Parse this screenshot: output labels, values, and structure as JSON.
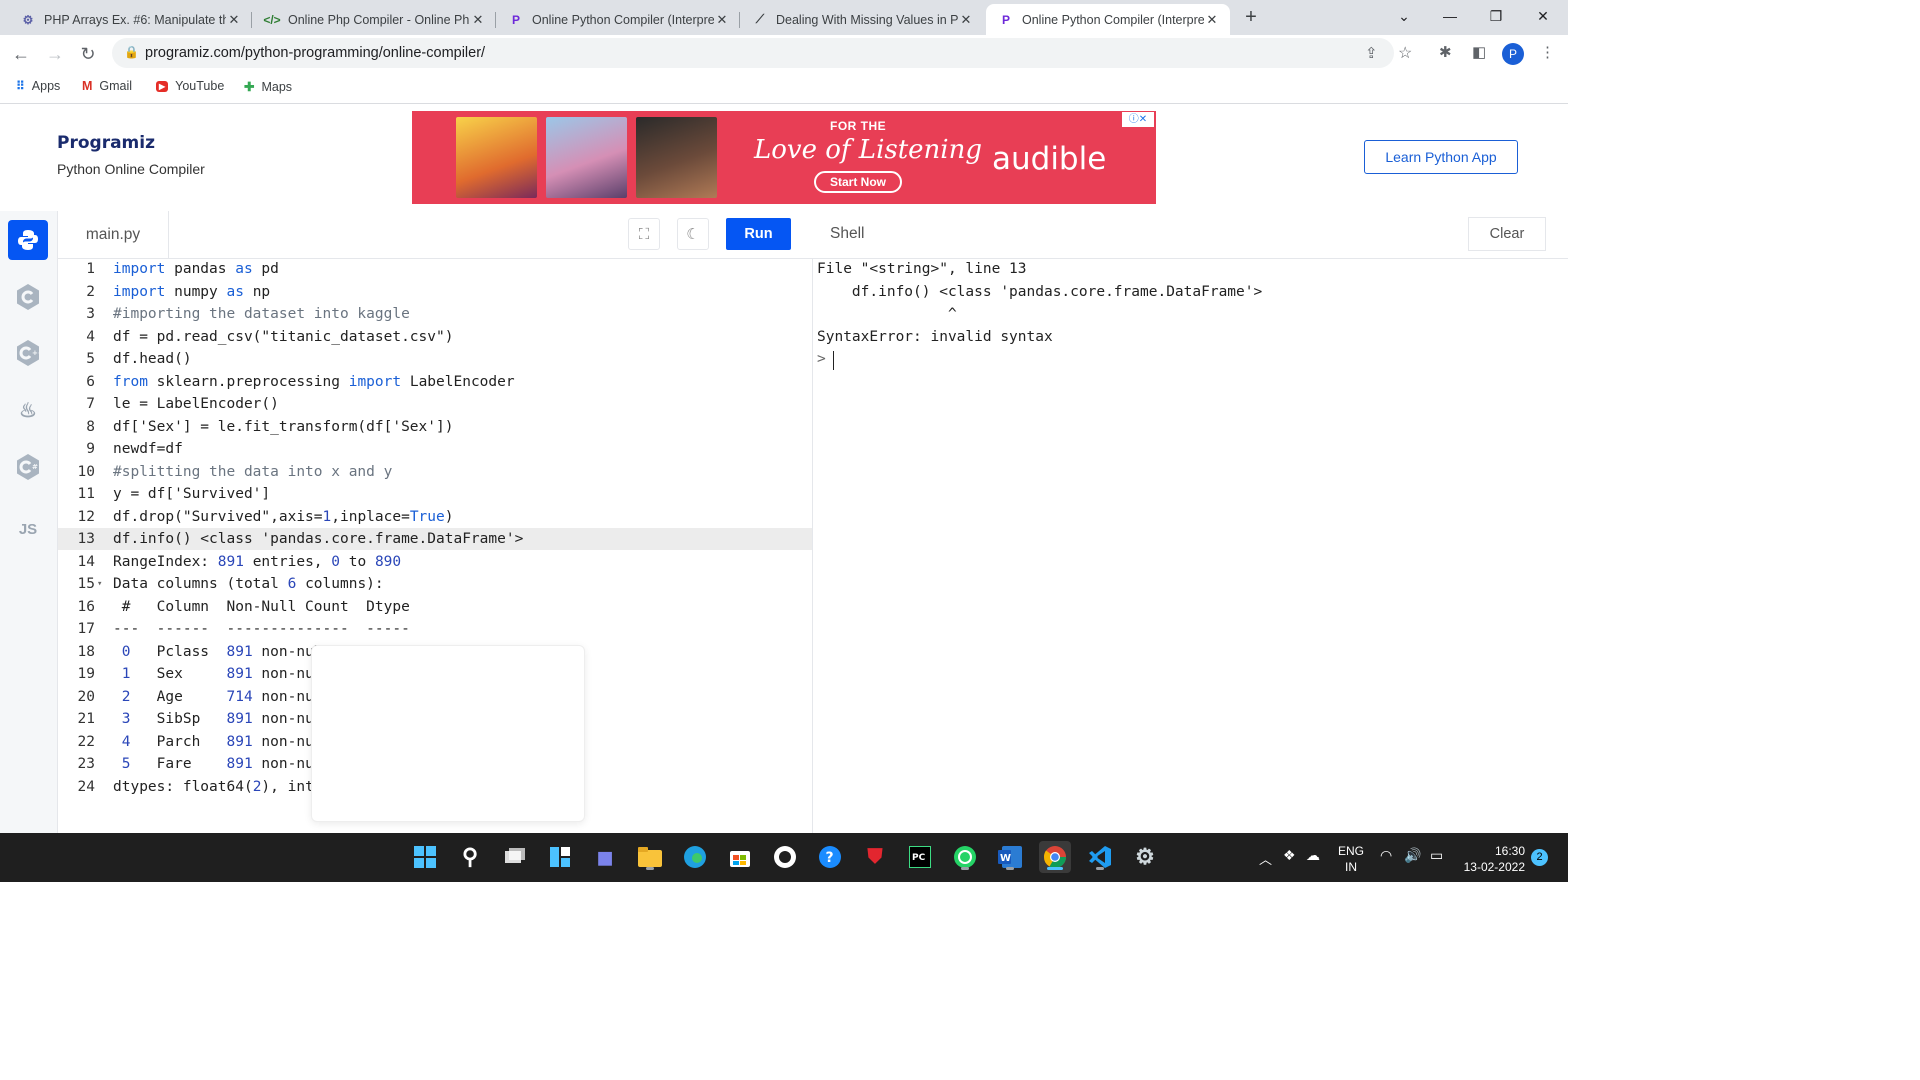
{
  "browser": {
    "tabs": [
      {
        "title": "PHP Arrays Ex. #6: Manipulate th",
        "icon": "php-tab-icon"
      },
      {
        "title": "Online Php Compiler - Online Ph",
        "icon": "code-tab-icon"
      },
      {
        "title": "Online Python Compiler (Interpre",
        "icon": "programiz-tab-icon"
      },
      {
        "title": "Dealing With Missing Values in P",
        "icon": "chart-tab-icon"
      },
      {
        "title": "Online Python Compiler (Interpre",
        "icon": "programiz-tab-icon",
        "active": true
      }
    ],
    "new_tab": "+",
    "url": "programiz.com/python-programming/online-compiler/",
    "profile_initial": "P",
    "bookmarks": [
      "Apps",
      "Gmail",
      "YouTube",
      "Maps"
    ]
  },
  "site": {
    "logo": "Programiz",
    "subtitle": "Python Online Compiler",
    "learn_button": "Learn Python App",
    "ad": {
      "tagline_top": "FOR THE",
      "tagline": "Love of Listening",
      "cta": "Start Now",
      "brand": "audible"
    }
  },
  "rail": {
    "items": [
      "python",
      "c",
      "cpp",
      "java",
      "csharp",
      "JS"
    ]
  },
  "editor": {
    "filename": "main.py",
    "run_label": "Run",
    "lines": [
      {
        "n": "1",
        "t": "import pandas as pd"
      },
      {
        "n": "2",
        "t": "import numpy as np"
      },
      {
        "n": "3",
        "t": "#importing the dataset into kaggle"
      },
      {
        "n": "4",
        "t": "df = pd.read_csv(\"titanic_dataset.csv\")"
      },
      {
        "n": "5",
        "t": "df.head()"
      },
      {
        "n": "6",
        "t": "from sklearn.preprocessing import LabelEncoder"
      },
      {
        "n": "7",
        "t": "le = LabelEncoder()"
      },
      {
        "n": "8",
        "t": "df['Sex'] = le.fit_transform(df['Sex'])"
      },
      {
        "n": "9",
        "t": "newdf=df"
      },
      {
        "n": "10",
        "t": "#splitting the data into x and y"
      },
      {
        "n": "11",
        "t": "y = df['Survived']"
      },
      {
        "n": "12",
        "t": "df.drop(\"Survived\",axis=1,inplace=True)"
      },
      {
        "n": "13",
        "t": "df.info() <class 'pandas.core.frame.DataFrame'>"
      },
      {
        "n": "14",
        "t": "RangeIndex: 891 entries, 0 to 890"
      },
      {
        "n": "15",
        "t": "Data columns (total 6 columns):"
      },
      {
        "n": "16",
        "t": " #   Column  Non-Null Count  Dtype"
      },
      {
        "n": "17",
        "t": "---  ------  --------------  -----"
      },
      {
        "n": "18",
        "t": " 0   Pclass  891 non-null    int64"
      },
      {
        "n": "19",
        "t": " 1   Sex     891 non-null    int64"
      },
      {
        "n": "20",
        "t": " 2   Age     714 non-null    float64"
      },
      {
        "n": "21",
        "t": " 3   SibSp   891 non-null    int64"
      },
      {
        "n": "22",
        "t": " 4   Parch   891 non-null    int64"
      },
      {
        "n": "23",
        "t": " 5   Fare    891 non-null    float64"
      },
      {
        "n": "24",
        "t": "dtypes: float64(2), int64(4)"
      }
    ],
    "active_line": 13,
    "fold_line": 15
  },
  "shell": {
    "title": "Shell",
    "clear_label": "Clear",
    "lines": [
      "File \"<string>\", line 13",
      "    df.info() <class 'pandas.core.frame.DataFrame'>",
      "               ^",
      "SyntaxError: invalid syntax",
      ">"
    ]
  },
  "taskbar": {
    "apps": [
      "windows-start",
      "search",
      "task-view",
      "widgets",
      "teams-chat",
      "file-explorer",
      "edge",
      "store",
      "github",
      "help",
      "mcafee",
      "pycharm",
      "whatsapp",
      "word",
      "chrome",
      "vscode",
      "settings"
    ],
    "lang_top": "ENG",
    "lang_bottom": "IN",
    "time": "16:30",
    "date": "13-02-2022",
    "notifications": "2"
  },
  "colors": {
    "accent": "#0556f3",
    "brand": "#1a2b6d",
    "ad_bg": "#e83e55",
    "taskbar": "#1f1f1f"
  }
}
